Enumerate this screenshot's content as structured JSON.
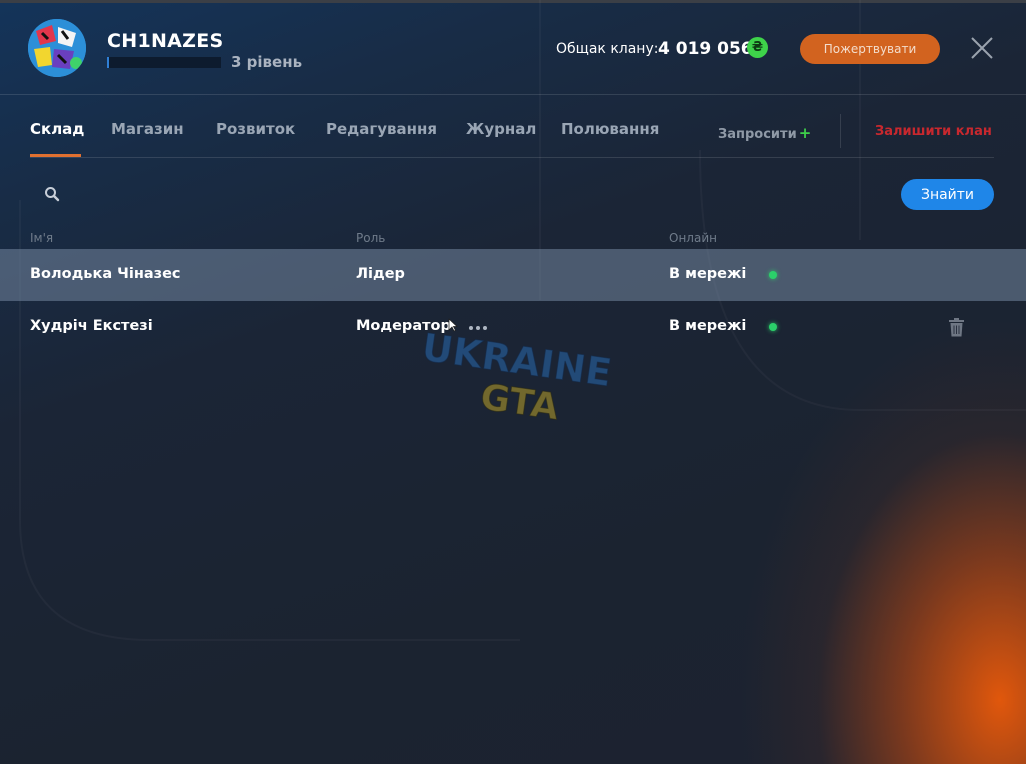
{
  "header": {
    "clan_name": "CH1NAZES",
    "level_label": "3 рівень",
    "level_progress": 0.02,
    "bank_label": "Общак клану:",
    "bank_value": "4 019 056",
    "currency_symbol": "₴",
    "donate_label": "Пожертвувати"
  },
  "tabs": [
    {
      "label": "Склад",
      "active": true
    },
    {
      "label": "Магазин"
    },
    {
      "label": "Розвиток"
    },
    {
      "label": "Редагування"
    },
    {
      "label": "Журнал"
    },
    {
      "label": "Полювання"
    }
  ],
  "actions": {
    "invite_label": "Запросити",
    "invite_plus": "+",
    "leave_label": "Залишити клан"
  },
  "search": {
    "placeholder": "",
    "find_label": "Знайти"
  },
  "table": {
    "columns": [
      "Ім'я",
      "Роль",
      "Онлайн"
    ],
    "rows": [
      {
        "name": "Володька Чіназес",
        "role": "Лідер",
        "status": "В мережі",
        "selected": true
      },
      {
        "name": "Худріч Екстезі",
        "role": "Модератор",
        "status": "В мережі",
        "selected": false
      }
    ]
  },
  "watermark": {
    "line1": "UKRAINE",
    "line2": "GTA"
  },
  "colors": {
    "accent_orange": "#e07030",
    "donate": "#d2631f",
    "find": "#1f86e8",
    "online": "#2bd06a",
    "leave": "#c8282e",
    "currency": "#3ed34a"
  }
}
